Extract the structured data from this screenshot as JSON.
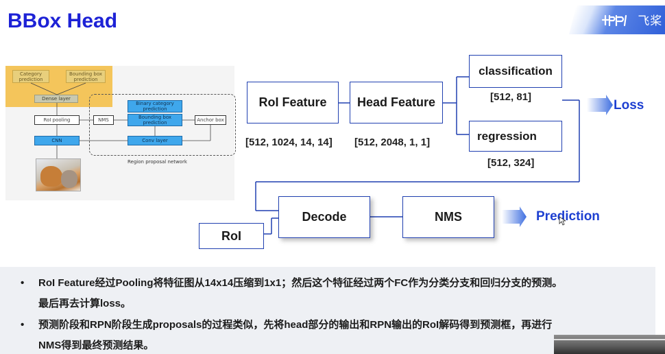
{
  "slide": {
    "title": "BBox Head",
    "logo": {
      "text": "飞桨"
    }
  },
  "figure": {
    "category_prediction": "Category prediction",
    "bbox_prediction": "Bounding box prediction",
    "dense_layer": "Dense layer",
    "roi_pooling": "RoI pooling",
    "cnn": "CNN",
    "nms": "NMS",
    "binary_category_prediction": "Binary category prediction",
    "rpn_bbox_prediction": "Bounding box prediction",
    "conv_layer": "Conv layer",
    "anchor_box": "Anchor box",
    "rpn_caption": "Region proposal network"
  },
  "diagram": {
    "roi_feature": "RoI Feature",
    "roi_feature_shape": "[512, 1024, 14, 14]",
    "head_feature": "Head Feature",
    "head_feature_shape": "[512, 2048, 1, 1]",
    "classification": "classification",
    "classification_shape": "[512, 81]",
    "regression": "regression",
    "regression_shape": "[512, 324]",
    "loss": "Loss",
    "roi": "RoI",
    "decode": "Decode",
    "nms": "NMS",
    "prediction": "Prediction"
  },
  "notes": {
    "bullet1_line1": "RoI Feature经过Pooling将特征图从14x14压缩到1x1；然后这个特征经过两个FC作为分类分支和回归分支的预测。",
    "bullet1_line2": "最后再去计算loss。",
    "bullet2_line1": "预测阶段和RPN阶段生成proposals的过程类似，先将head部分的输出和RPN输出的RoI解码得到预测框，再进行",
    "bullet2_line2": "NMS得到最终预测结果。"
  },
  "colors": {
    "title": "#1d22d6",
    "box_border": "#1f3fb0",
    "output_label": "#1d3fd1",
    "arrow_gradient_start": "#ffffff",
    "arrow_gradient_end": "#3f6fe0",
    "notes_background": "#eef0f4"
  }
}
